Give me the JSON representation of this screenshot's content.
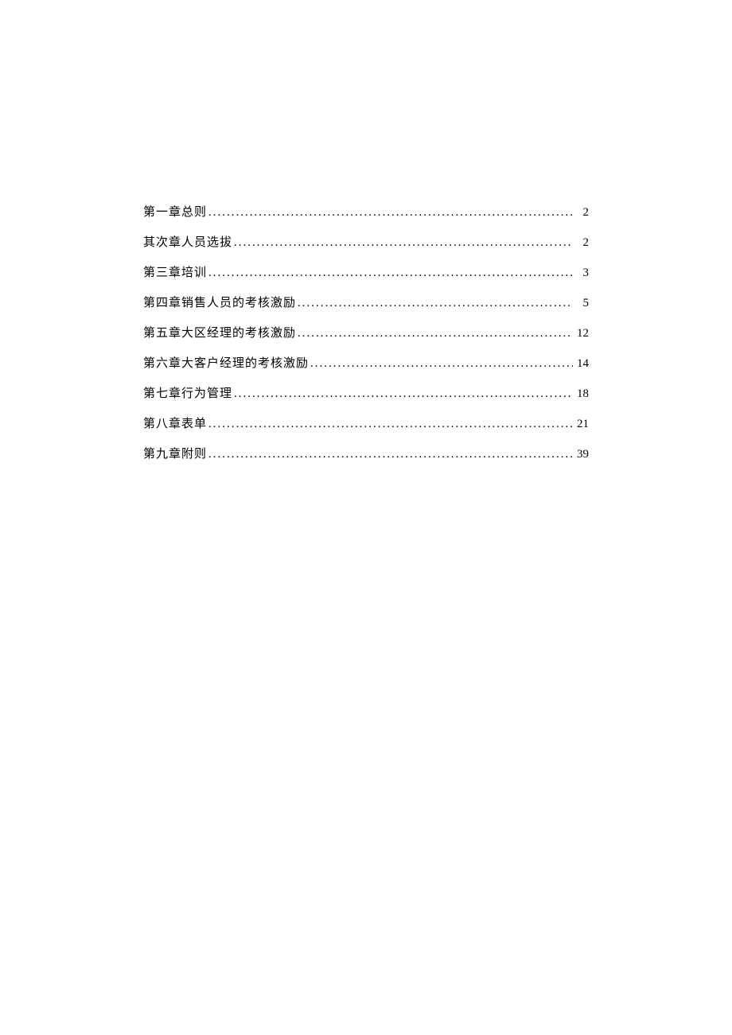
{
  "toc": {
    "entries": [
      {
        "title": "第一章总则",
        "page": "2"
      },
      {
        "title": "其次章人员选拔",
        "page": "2"
      },
      {
        "title": "第三章培训",
        "page": "3"
      },
      {
        "title": "第四章销售人员的考核激励",
        "page": "5"
      },
      {
        "title": "第五章大区经理的考核激励",
        "page": "12"
      },
      {
        "title": "第六章大客户经理的考核激励",
        "page": "14"
      },
      {
        "title": "第七章行为管理",
        "page": "18"
      },
      {
        "title": "第八章表单",
        "page": "21"
      },
      {
        "title": "第九章附则",
        "page": "39"
      }
    ]
  }
}
